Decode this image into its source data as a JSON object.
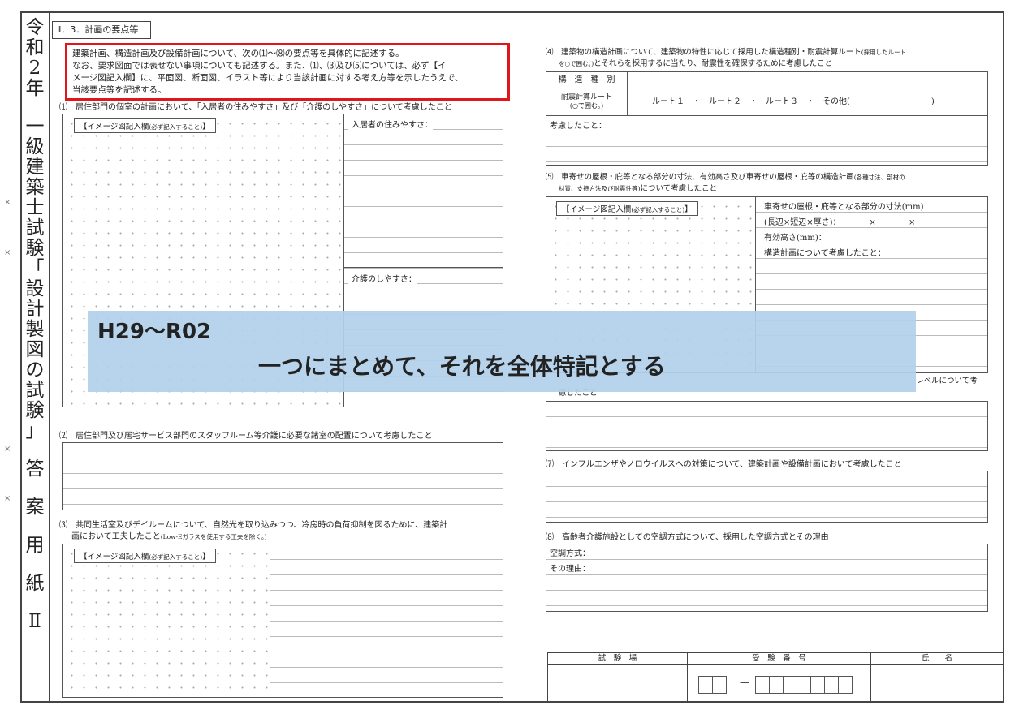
{
  "vertical_title_chars": [
    "令",
    "和",
    "2",
    "年",
    "",
    "一",
    "級",
    "建",
    "築",
    "士",
    "試",
    "験",
    "「",
    "設",
    "計",
    "製",
    "図",
    "の",
    "試",
    "験",
    "」",
    "",
    "答",
    "",
    "案",
    "",
    "用",
    "",
    "紙",
    "",
    "Ⅱ"
  ],
  "margin_marks": [
    "×",
    "×",
    "×",
    "×"
  ],
  "section_heading": "Ⅱ．3．計画の要点等",
  "instructions": {
    "line1": "建築計画、構造計画及び設備計画について、次の⑴〜⑻の要点等を具体的に記述する。",
    "line2": "なお、要求図面では表せない事項についても記述する。また、⑴、⑶及び⑸については、必ず【イ",
    "line3": "メージ図記入欄】に、平面図、断面図、イラスト等により当該計画に対する考え方等を示したうえで、",
    "line4": "当該要点等を記述する。"
  },
  "q1": {
    "text": "⑴　居住部門の個室の計画において、「入居者の住みやすさ」及び「介護のしやすさ」について考慮したこと",
    "image_label": "【イメージ図記入欄",
    "image_label_note": "(必ず記入すること)",
    "image_label_end": "】",
    "side_label_1": "入居者の住みやすさ：",
    "side_label_2": "介護のしやすさ："
  },
  "q2": {
    "text": "⑵　居住部門及び居宅サービス部門のスタッフルーム等介護に必要な諸室の配置について考慮したこと"
  },
  "q3": {
    "text_line1": "⑶　共同生活室及びデイルームについて、自然光を取り込みつつ、冷房時の負荷抑制を図るために、建築計",
    "text_line2": "画において工夫したこと",
    "text_note": "(Low-Eガラスを使用する工夫を除く。)",
    "image_label": "【イメージ図記入欄",
    "image_label_note": "(必ず記入すること)",
    "image_label_end": "】"
  },
  "q4": {
    "text_line1": "⑷　建築物の構造計画について、建築物の特性に応じて採用した構造種別・耐震計算ルート",
    "text_line1_note": "(採用したルート",
    "text_line2_note": "を○で囲む。)",
    "text_line2": "とそれらを採用するに当たり、耐震性を確保するために考慮したこと",
    "row1_label": "構　造　種　別",
    "row2_label_1": "耐震計算ルート",
    "row2_label_2": "(○で囲む。)",
    "row2_options": "ルート１　・　ルート２　・　ルート３　・　その他(　　　　　　　　　　)",
    "row3_label": "考慮したこと："
  },
  "q5": {
    "text_line1": "⑸　車寄せの屋根・庇等となる部分の寸法、有効高さ及び車寄せの屋根・庇等の構造計画",
    "text_line1_note": "(各種寸法、部材の",
    "text_line2_note": "材質、支持方法及び耐震性等)",
    "text_line2": "について考慮したこと",
    "image_label": "【イメージ図記入欄",
    "image_label_note": "(必ず記入すること)",
    "image_label_end": "】",
    "field_1": "車寄せの屋根・庇等となる部分の寸法(mm)",
    "field_2": "(長辺×短辺×厚さ)：　　　　×　　　　×",
    "field_3": "有効高さ(mm)：",
    "field_4": "構造計画について考慮したこと："
  },
  "q6": {
    "text_tail": "レベルについて考",
    "text_line2": "慮したこと"
  },
  "q7": {
    "text": "⑺　インフルエンザやノロウイルスへの対策について、建築計画や設備計画において考慮したこと"
  },
  "q8": {
    "text": "⑻　高齢者介護施設としての空調方式について、採用した空調方式とその理由",
    "field_1": "空調方式：",
    "field_2": "その理由："
  },
  "signature": {
    "col1": "試　験　場",
    "col2": "受　験　番　号",
    "col3": "氏　　名",
    "dash": "—"
  },
  "overlay": {
    "line1": "H29〜R02",
    "line2": "一つにまとめて、それを全体特記とする",
    "color": "#b2d1eb"
  }
}
